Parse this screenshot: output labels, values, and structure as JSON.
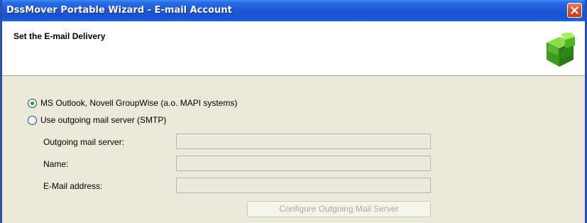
{
  "window": {
    "title": "DssMover Portable Wizard - E-mail Account",
    "close_icon": "close-icon"
  },
  "header": {
    "title": "Set the E-mail Delivery",
    "logo_icon": "green-cube-icon"
  },
  "delivery": {
    "options": [
      {
        "label": "MS Outlook, Novell GroupWise (a.o. MAPI systems)",
        "selected": true
      },
      {
        "label": "Use outgoing mail server (SMTP)",
        "selected": false
      }
    ]
  },
  "smtp": {
    "fields": [
      {
        "label": "Outgoing mail server:",
        "value": ""
      },
      {
        "label": "Name:",
        "value": ""
      },
      {
        "label": "E-Mail address:",
        "value": ""
      }
    ],
    "configure_label": "Configure Outgoing Mail Server"
  },
  "colors": {
    "titlebar": "#1f5ad6",
    "dialog_bg": "#ece9d8",
    "radio_dot": "#21a121",
    "close_button": "#d8502f"
  }
}
